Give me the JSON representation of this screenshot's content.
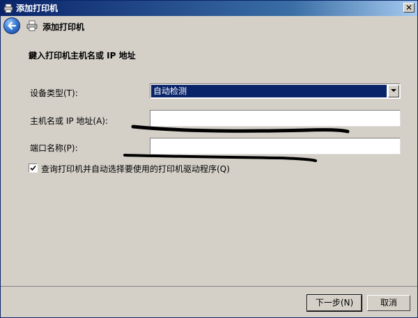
{
  "window": {
    "title": "添加打印机",
    "close_glyph": "✕",
    "title_icon": "printer-icon"
  },
  "nav": {
    "back_icon": "back-arrow-icon",
    "printer_icon": "printer-icon",
    "title": "添加打印机"
  },
  "form": {
    "heading": "鍵入打印机主机名或 IP 地址",
    "device_type": {
      "label": "设备类型(T):",
      "selected": "自动检测"
    },
    "hostname": {
      "label": "主机名或 IP 地址(A):",
      "value": ""
    },
    "port_name": {
      "label": "端口名称(P):",
      "value": ""
    },
    "auto_detect_driver": {
      "label": "查询打印机并自动选择要使用的打印机驱动程序(Q)",
      "checked": true
    }
  },
  "buttons": {
    "next": "下一步(N)",
    "cancel": "取消"
  },
  "colors": {
    "title_bar": "#0a246a",
    "selection": "#0a246a",
    "dialog_face": "#d4d0c8",
    "scribble": "#000000"
  }
}
